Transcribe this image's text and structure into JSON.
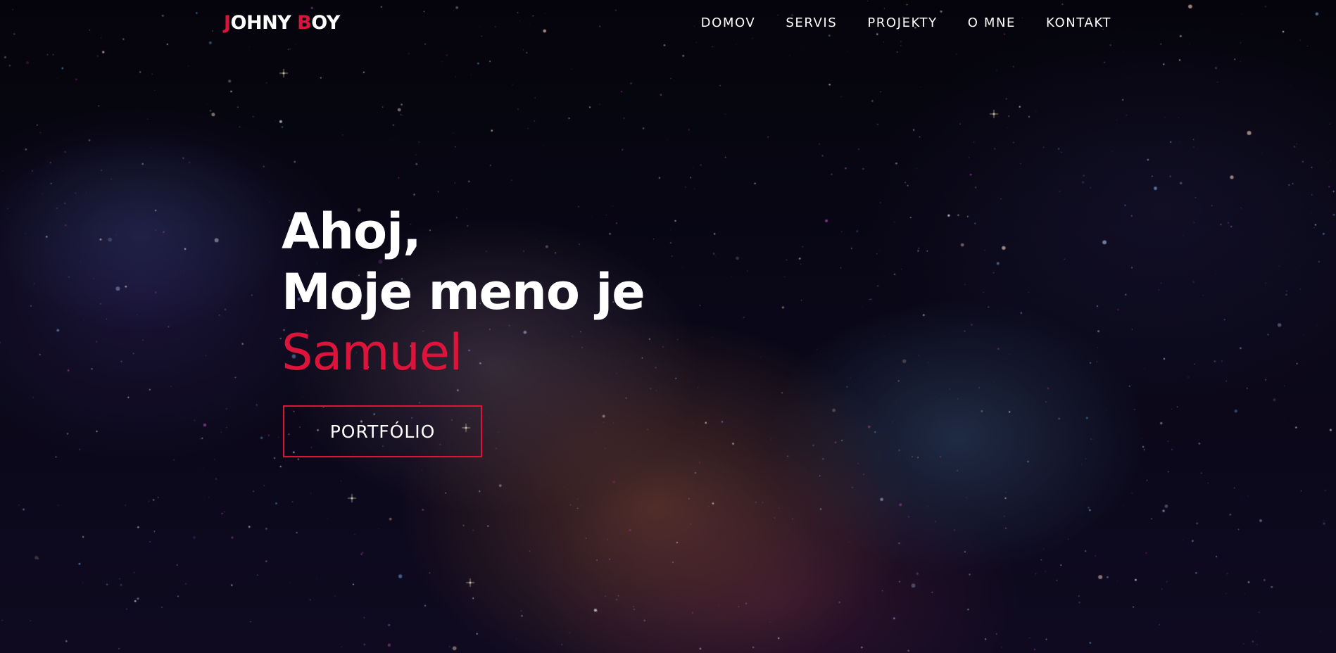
{
  "brand": {
    "first_initial": "J",
    "first_rest": "OHNY ",
    "last_initial": "B",
    "last_rest": "OY",
    "accent_color": "#dc143c",
    "text_color": "#ffffff"
  },
  "nav": {
    "items": [
      {
        "label": "DOMOV"
      },
      {
        "label": "SERVIS"
      },
      {
        "label": "PROJEKTY"
      },
      {
        "label": "O MNE"
      },
      {
        "label": "KONTAKT"
      }
    ]
  },
  "hero": {
    "line1": "Ahoj,",
    "line2": "Moje meno je",
    "name": "Samuel",
    "button_label": "PORTFÓLIO"
  }
}
